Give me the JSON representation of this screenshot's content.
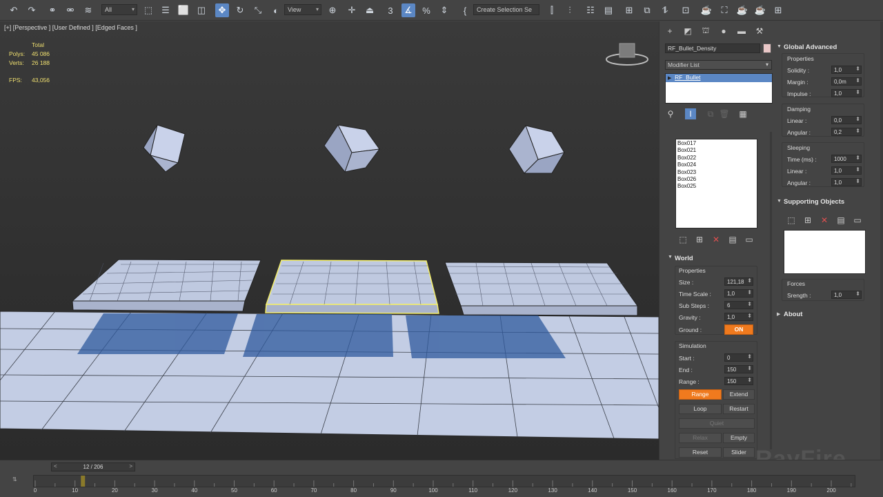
{
  "toolbar": {
    "filter_value": "All",
    "refcoord_value": "View",
    "selection_set_placeholder": "Create Selection Se"
  },
  "viewport": {
    "label": "[+] [Perspective ] [User Defined ] [Edged Faces ]",
    "stats": {
      "total_label": "Total",
      "polys_label": "Polys:",
      "polys_value": "45 086",
      "verts_label": "Verts:",
      "verts_value": "26 188",
      "fps_label": "FPS:",
      "fps_value": "43,056"
    },
    "watermark": "RayFire"
  },
  "command_panel": {
    "object_name": "RF_Bullet_Density",
    "modifier_list_label": "Modifier List",
    "stack_item": "RF_Bullet",
    "objects_list": [
      "Box017",
      "Box021",
      "Box022",
      "Box024",
      "Box023",
      "Box026",
      "Box025"
    ],
    "world": {
      "header": "World",
      "properties_label": "Properties",
      "size_label": "Size :",
      "size_value": "121,18",
      "timescale_label": "Time Scale :",
      "timescale_value": "1,0",
      "substeps_label": "Sub Steps :",
      "substeps_value": "6",
      "gravity_label": "Gravity :",
      "gravity_value": "1,0",
      "ground_label": "Ground :",
      "ground_value": "ON",
      "simulation_label": "Simulation",
      "start_label": "Start :",
      "start_value": "0",
      "end_label": "End :",
      "end_value": "150",
      "range_label": "Range :",
      "range_value": "150",
      "btn_range": "Range",
      "btn_extend": "Extend",
      "btn_loop": "Loop",
      "btn_restart": "Restart",
      "btn_quiet": "Quiet",
      "btn_relax": "Relax",
      "btn_empty": "Empty",
      "btn_reset": "Reset",
      "btn_slider": "Slider"
    }
  },
  "rayfire_panel": {
    "global_header": "Global Advanced",
    "properties_label": "Properties",
    "solidity_label": "Solidity :",
    "solidity_value": "1,0",
    "margin_label": "Margin :",
    "margin_value": "0,0m",
    "impulse_label": "Impulse :",
    "impulse_value": "1,0",
    "damping_label": "Damping",
    "d_linear_label": "Linear :",
    "d_linear_value": "0,0",
    "d_angular_label": "Angular :",
    "d_angular_value": "0,2",
    "sleeping_label": "Sleeping",
    "time_label": "Time (ms) :",
    "time_value": "1000",
    "s_linear_label": "Linear :",
    "s_linear_value": "1,0",
    "s_angular_label": "Angular :",
    "s_angular_value": "1,0",
    "supporting_header": "Supporting Objects",
    "forces_label": "Forces",
    "strength_label": "Srength :",
    "strength_value": "1,0",
    "about_header": "About"
  },
  "timeline": {
    "frame_display": "12 / 206",
    "current_frame": 12,
    "ticks": [
      "0",
      "10",
      "20",
      "30",
      "40",
      "50",
      "60",
      "70",
      "80",
      "90",
      "100",
      "110",
      "120",
      "130",
      "140",
      "150",
      "160",
      "170",
      "180",
      "190",
      "200"
    ]
  },
  "colors": {
    "accent": "#5b87c4",
    "orange": "#f07a1e",
    "selection_yellow": "#f5f06a",
    "mesh": "#c3cde4"
  }
}
